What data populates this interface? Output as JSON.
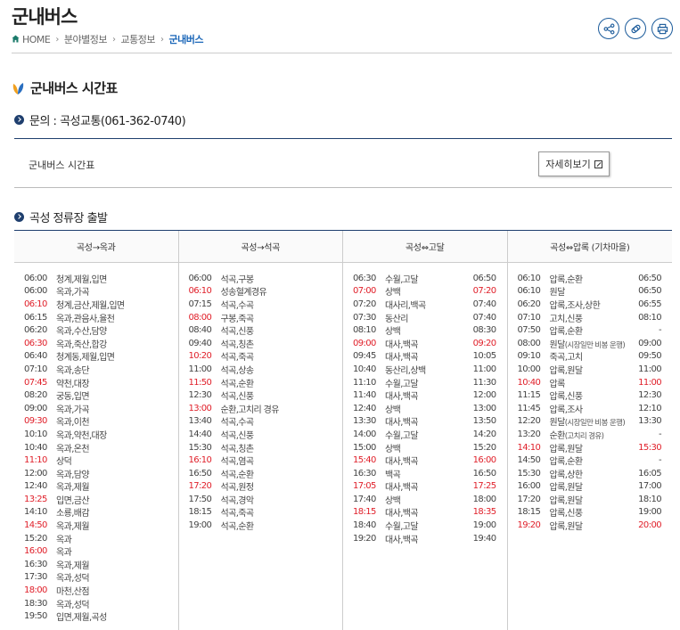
{
  "page": {
    "title": "군내버스",
    "breadcrumb": [
      "HOME",
      "분야별정보",
      "교통정보",
      "군내버스"
    ],
    "section_title": "군내버스 시간표",
    "inquiry": "문의 : 곡성교통(061-362-0740)",
    "info_label": "군내버스 시간표",
    "detail_button": "자세히보기",
    "departure_title": "곡성 정류장 출발"
  },
  "icons": [
    "share-icon",
    "link-icon",
    "print-icon",
    "home-icon",
    "external-link-icon"
  ],
  "colors": {
    "accent": "#1a66b8",
    "navy": "#1f3f6e",
    "highlight": "#e0202a"
  },
  "timetable": [
    {
      "header": "곡성→옥과",
      "rows": [
        {
          "time": "06:00",
          "dest": "청계,제월,입면",
          "red": false
        },
        {
          "time": "06:00",
          "dest": "옥과,가곡",
          "red": false
        },
        {
          "time": "06:10",
          "dest": "청계,금산,제월,입면",
          "red": true
        },
        {
          "time": "06:15",
          "dest": "옥과,관음사,율천",
          "red": false
        },
        {
          "time": "06:20",
          "dest": "옥과,수산,담양",
          "red": false
        },
        {
          "time": "06:30",
          "dest": "옥과,죽산,합강",
          "red": true
        },
        {
          "time": "06:40",
          "dest": "청계동,제월,입면",
          "red": false
        },
        {
          "time": "07:10",
          "dest": "옥과,송단",
          "red": false
        },
        {
          "time": "07:45",
          "dest": "약천,대장",
          "red": true
        },
        {
          "time": "08:20",
          "dest": "궁동,입면",
          "red": false
        },
        {
          "time": "09:00",
          "dest": "옥과,가곡",
          "red": false
        },
        {
          "time": "09:30",
          "dest": "옥과,이천",
          "red": true
        },
        {
          "time": "10:10",
          "dest": "옥과,약천,대장",
          "red": false
        },
        {
          "time": "10:40",
          "dest": "옥과,온천",
          "red": false
        },
        {
          "time": "11:10",
          "dest": "상덕",
          "red": true
        },
        {
          "time": "12:00",
          "dest": "옥과,담양",
          "red": false
        },
        {
          "time": "12:40",
          "dest": "옥과,제월",
          "red": false
        },
        {
          "time": "13:25",
          "dest": "입면,금산",
          "red": true
        },
        {
          "time": "14:10",
          "dest": "소룡,배감",
          "red": false
        },
        {
          "time": "14:50",
          "dest": "옥과,제월",
          "red": true
        },
        {
          "time": "15:20",
          "dest": "옥과",
          "red": false
        },
        {
          "time": "16:00",
          "dest": "옥과",
          "red": true
        },
        {
          "time": "16:30",
          "dest": "옥과,제월",
          "red": false
        },
        {
          "time": "17:30",
          "dest": "옥과,성덕",
          "red": false
        },
        {
          "time": "18:00",
          "dest": "마천,산점",
          "red": true
        },
        {
          "time": "18:30",
          "dest": "옥과,성덕",
          "red": false
        },
        {
          "time": "19:50",
          "dest": "입면,제월,곡성",
          "red": false
        }
      ]
    },
    {
      "header": "곡성→석곡",
      "rows": [
        {
          "time": "06:00",
          "dest": "석곡,구봉",
          "red": false
        },
        {
          "time": "06:10",
          "dest": "성송혈계경유",
          "red": true
        },
        {
          "time": "07:15",
          "dest": "석곡,수곡",
          "red": false
        },
        {
          "time": "08:00",
          "dest": "구봉,죽곡",
          "red": true
        },
        {
          "time": "08:40",
          "dest": "석곡,신풍",
          "red": false
        },
        {
          "time": "09:40",
          "dest": "석곡,칭촌",
          "red": false
        },
        {
          "time": "10:20",
          "dest": "석곡,죽곡",
          "red": true
        },
        {
          "time": "11:00",
          "dest": "석곡,상송",
          "red": false
        },
        {
          "time": "11:50",
          "dest": "석곡,순환",
          "red": true
        },
        {
          "time": "12:30",
          "dest": "석곡,신풍",
          "red": false
        },
        {
          "time": "13:00",
          "dest": "순환,고치리 경유",
          "red": true
        },
        {
          "time": "13:40",
          "dest": "석곡,수곡",
          "red": false
        },
        {
          "time": "14:40",
          "dest": "석곡,신풍",
          "red": false
        },
        {
          "time": "15:30",
          "dest": "석곡,칭촌",
          "red": false
        },
        {
          "time": "16:10",
          "dest": "석곡,염곡",
          "red": true
        },
        {
          "time": "16:50",
          "dest": "석곡,순환",
          "red": false
        },
        {
          "time": "17:20",
          "dest": "석곡,원정",
          "red": true
        },
        {
          "time": "17:50",
          "dest": "석곡,경악",
          "red": false
        },
        {
          "time": "18:15",
          "dest": "석곡,죽곡",
          "red": false
        },
        {
          "time": "19:00",
          "dest": "석곡,순환",
          "red": false
        }
      ]
    },
    {
      "header": "곡성⇔고달",
      "rows": [
        {
          "time": "06:30",
          "dest": "수월,고달",
          "arr": "06:50",
          "red": false
        },
        {
          "time": "07:00",
          "dest": "상백",
          "arr": "07:20",
          "red": true
        },
        {
          "time": "07:20",
          "dest": "대사리,백곡",
          "arr": "07:40",
          "red": false
        },
        {
          "time": "07:30",
          "dest": "동산리",
          "arr": "07:40",
          "red": false
        },
        {
          "time": "08:10",
          "dest": "상백",
          "arr": "08:30",
          "red": false
        },
        {
          "time": "09:00",
          "dest": "대사,백곡",
          "arr": "09:20",
          "red": true
        },
        {
          "time": "09:45",
          "dest": "대사,백곡",
          "arr": "10:05",
          "red": false
        },
        {
          "time": "10:40",
          "dest": "동산리,상백",
          "arr": "11:00",
          "red": false
        },
        {
          "time": "11:10",
          "dest": "수월,고달",
          "arr": "11:30",
          "red": false
        },
        {
          "time": "11:40",
          "dest": "대사,백곡",
          "arr": "12:00",
          "red": false
        },
        {
          "time": "12:40",
          "dest": "상백",
          "arr": "13:00",
          "red": false
        },
        {
          "time": "13:30",
          "dest": "대사,백곡",
          "arr": "13:50",
          "red": false
        },
        {
          "time": "14:00",
          "dest": "수월,고달",
          "arr": "14:20",
          "red": false
        },
        {
          "time": "15:00",
          "dest": "상백",
          "arr": "15:20",
          "red": false
        },
        {
          "time": "15:40",
          "dest": "대사,백곡",
          "arr": "16:00",
          "red": true
        },
        {
          "time": "16:30",
          "dest": "백곡",
          "arr": "16:50",
          "red": false
        },
        {
          "time": "17:05",
          "dest": "대사,백곡",
          "arr": "17:25",
          "red": true
        },
        {
          "time": "17:40",
          "dest": "상백",
          "arr": "18:00",
          "red": false
        },
        {
          "time": "18:15",
          "dest": "대사,백곡",
          "arr": "18:35",
          "red": true
        },
        {
          "time": "18:40",
          "dest": "수월,고달",
          "arr": "19:00",
          "red": false
        },
        {
          "time": "19:20",
          "dest": "대사,백곡",
          "arr": "19:40",
          "red": false
        }
      ]
    },
    {
      "header": "곡성⇔압록 (기차마을)",
      "rows": [
        {
          "time": "06:10",
          "dest": "압록,순환",
          "arr": "06:50",
          "red": false
        },
        {
          "time": "06:10",
          "dest": "원달",
          "arr": "06:50",
          "red": false
        },
        {
          "time": "06:20",
          "dest": "압록,조사,상한",
          "arr": "06:55",
          "red": false
        },
        {
          "time": "07:10",
          "dest": "고치,신풍",
          "arr": "08:10",
          "red": false
        },
        {
          "time": "07:50",
          "dest": "압록,순환",
          "arr": "-",
          "red": false
        },
        {
          "time": "08:00",
          "dest": "원달",
          "note": "(시장일만 비봉 운행)",
          "arr": "09:00",
          "red": false
        },
        {
          "time": "09:10",
          "dest": "죽곡,고치",
          "arr": "09:50",
          "red": false
        },
        {
          "time": "10:00",
          "dest": "압록,원달",
          "arr": "11:00",
          "red": false
        },
        {
          "time": "10:40",
          "dest": "압록",
          "arr": "11:00",
          "red": true
        },
        {
          "time": "11:15",
          "dest": "압록,신풍",
          "arr": "12:30",
          "red": false
        },
        {
          "time": "11:45",
          "dest": "압록,조사",
          "arr": "12:10",
          "red": false
        },
        {
          "time": "12:20",
          "dest": "원달",
          "note": "(시장일만 비봉 운행)",
          "arr": "13:30",
          "red": false
        },
        {
          "time": "13:20",
          "dest": "순환",
          "note": "(고치리 경유)",
          "arr": "-",
          "red": false
        },
        {
          "time": "14:10",
          "dest": "압록,원달",
          "arr": "15:30",
          "red": true
        },
        {
          "time": "14:50",
          "dest": "압록,순환",
          "arr": "-",
          "red": false
        },
        {
          "time": "15:30",
          "dest": "압록,상한",
          "arr": "16:05",
          "red": false
        },
        {
          "time": "16:00",
          "dest": "압록,원달",
          "arr": "17:00",
          "red": false
        },
        {
          "time": "17:20",
          "dest": "압록,원달",
          "arr": "18:10",
          "red": false
        },
        {
          "time": "18:15",
          "dest": "압록,신풍",
          "arr": "19:00",
          "red": false
        },
        {
          "time": "19:20",
          "dest": "압록,원달",
          "arr": "20:00",
          "red": true
        }
      ]
    }
  ]
}
